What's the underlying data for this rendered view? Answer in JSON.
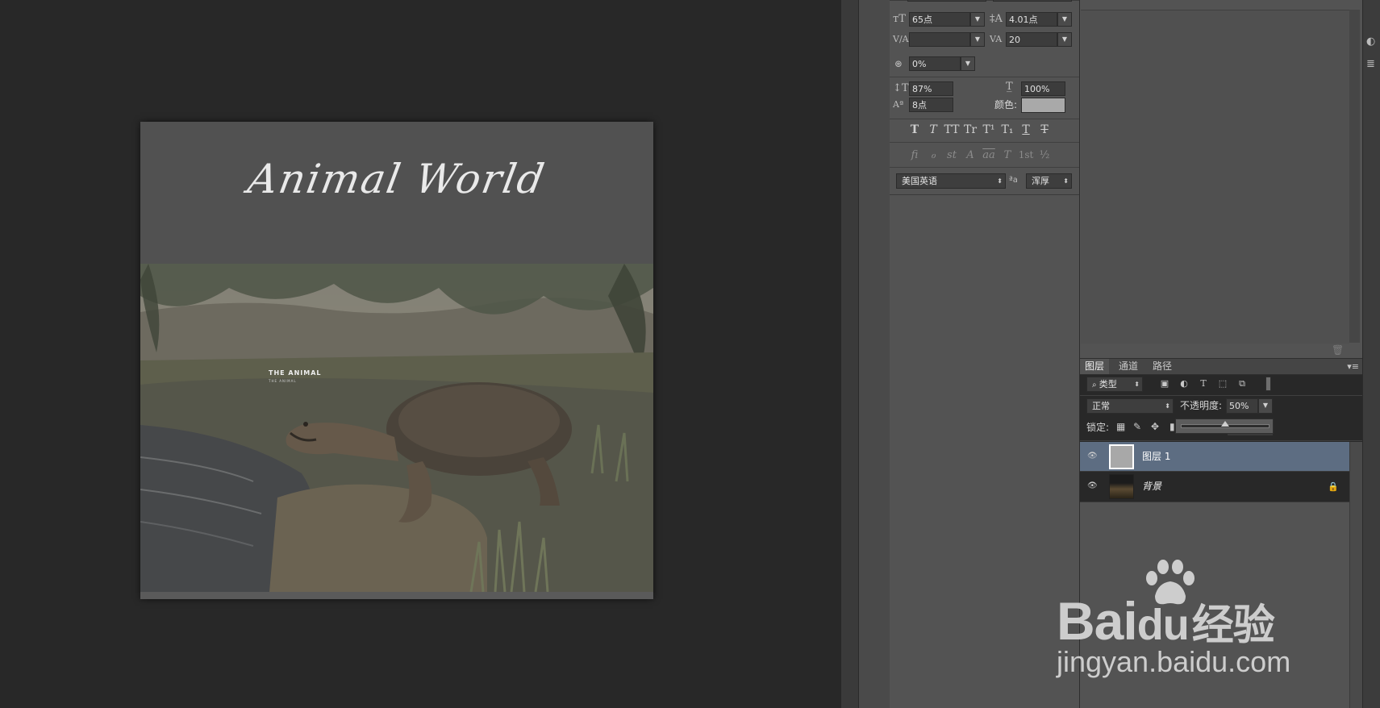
{
  "document": {
    "title": "Animal World",
    "photo_heading": "THE ANIMAL",
    "photo_subheading": "THE ANIMAL"
  },
  "character_panel": {
    "font_size": "65点",
    "leading": "4.01点",
    "kerning": "",
    "tracking": "20",
    "scale_percent": "0%",
    "vertical_scale": "87%",
    "horizontal_scale": "100%",
    "baseline_shift": "8点",
    "color_label": "颜色:",
    "color_value": "#a9a9a9",
    "style_buttons": [
      "T",
      "T",
      "TT",
      "Tr",
      "T¹",
      "T₁",
      "T",
      "T"
    ],
    "opentype_buttons": [
      "fi",
      "ℴ",
      "st",
      "A",
      "aa",
      "T",
      "1st",
      "½"
    ],
    "language": "美国英语",
    "aa_label": "ªa",
    "antialias": "浑厚"
  },
  "layers_panel": {
    "tabs": [
      "图层",
      "通道",
      "路径"
    ],
    "active_tab": "图层",
    "filter_kind": "类型",
    "blend_mode": "正常",
    "opacity_label": "不透明度:",
    "opacity_value": "50%",
    "opacity_level": 0.5,
    "lock_label": "锁定:",
    "layers": [
      {
        "name": "图层 1",
        "selected": true,
        "visible": true,
        "locked": false
      },
      {
        "name": "背景",
        "selected": false,
        "visible": true,
        "locked": true
      }
    ]
  },
  "watermark": {
    "brand": "Bai",
    "brand_suffix": "du",
    "brand_cn": "经验",
    "url": "jingyan.baidu.com"
  },
  "colors": {
    "canvas_bg": "#282828",
    "panel_bg": "#535353",
    "selected_layer": "#5d6d82"
  }
}
